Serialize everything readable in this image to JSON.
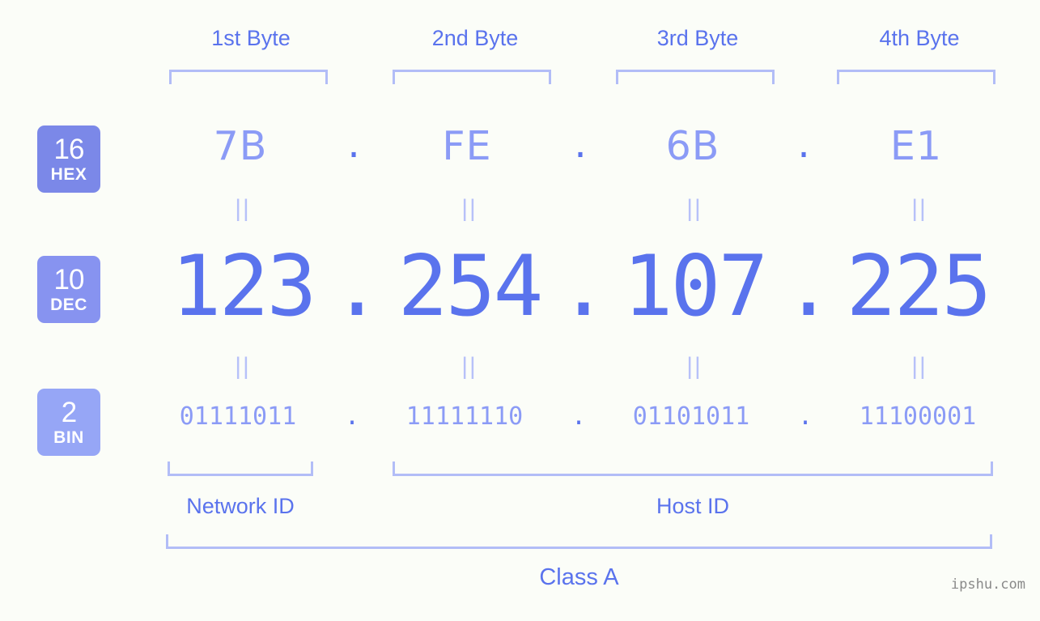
{
  "background_color": "#fbfdf8",
  "accent_color": "#5a73ed",
  "accent_light_color": "#8b9bf6",
  "bracket_color": "#b2bdf7",
  "byte_headers": [
    {
      "label": "1st Byte"
    },
    {
      "label": "2nd Byte"
    },
    {
      "label": "3rd Byte"
    },
    {
      "label": "4th Byte"
    }
  ],
  "rows": {
    "hex": {
      "badge_base": "16",
      "badge_name": "HEX",
      "badge_color": "#7b88e8",
      "values": [
        "7B",
        "FE",
        "6B",
        "E1"
      ],
      "separator": "."
    },
    "dec": {
      "badge_base": "10",
      "badge_name": "DEC",
      "badge_color": "#8793f0",
      "values": [
        "123",
        "254",
        "107",
        "225"
      ],
      "separator": "."
    },
    "bin": {
      "badge_base": "2",
      "badge_name": "BIN",
      "badge_color": "#96a6f6",
      "values": [
        "01111011",
        "11111110",
        "01101011",
        "11100001"
      ],
      "separator": "."
    }
  },
  "equality_marks": {
    "glyph": "||",
    "count_top": 4,
    "count_bottom": 4
  },
  "segments": {
    "network_id": {
      "label": "Network ID"
    },
    "host_id": {
      "label": "Host ID"
    }
  },
  "class": {
    "label": "Class A"
  },
  "watermark": {
    "text": "ipshu.com"
  }
}
